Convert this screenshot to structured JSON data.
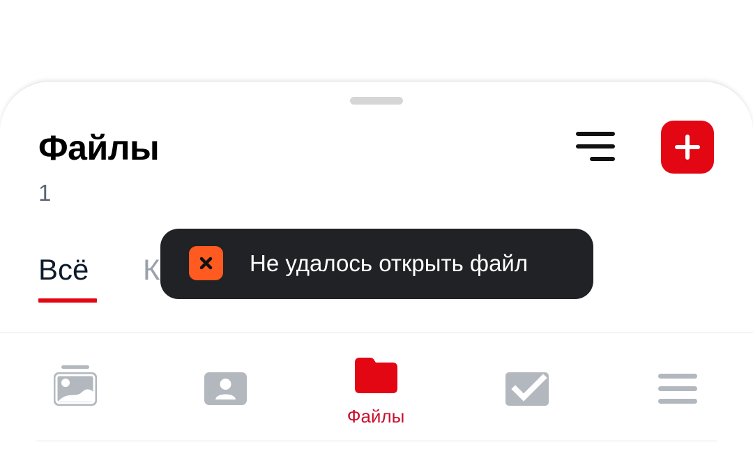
{
  "header": {
    "title": "Файлы",
    "count": "1"
  },
  "toolbar": {
    "sort_icon": "sort-lines-icon",
    "add_icon": "plus-icon"
  },
  "tabs": [
    {
      "label": "Всё",
      "active": true
    },
    {
      "label": "К",
      "active": false
    }
  ],
  "toast": {
    "icon": "error-x-icon",
    "message": "Не удалось открыть файл"
  },
  "bottom_nav": {
    "items": [
      {
        "icon": "gallery-icon",
        "label": "",
        "active": false
      },
      {
        "icon": "contacts-icon",
        "label": "",
        "active": false
      },
      {
        "icon": "folder-icon",
        "label": "Файлы",
        "active": true
      },
      {
        "icon": "checklist-icon",
        "label": "",
        "active": false
      },
      {
        "icon": "menu-icon",
        "label": "",
        "active": false
      }
    ]
  },
  "colors": {
    "accent": "#e30613",
    "toast_bg": "#202225",
    "toast_icon": "#ff5a1f",
    "nav_inactive": "#b3b8bf"
  }
}
